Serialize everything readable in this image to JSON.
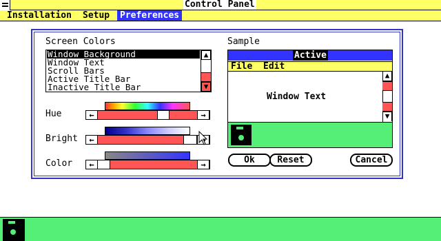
{
  "window": {
    "title": "Control Panel"
  },
  "menubar": {
    "items": [
      "Installation",
      "Setup",
      "Preferences"
    ],
    "active": "Preferences"
  },
  "screen_colors": {
    "heading": "Screen Colors",
    "items": [
      "Window Background",
      "Window Text",
      "Scroll Bars",
      "Active Title Bar",
      "Inactive Title Bar"
    ],
    "selected": "Window Background"
  },
  "sliders": {
    "hue": {
      "label": "Hue",
      "value": 0.64
    },
    "bright": {
      "label": "Bright",
      "value": 0.93
    },
    "color": {
      "label": "Color",
      "value": 0.12
    }
  },
  "sample": {
    "heading": "Sample",
    "title": "Active",
    "menu": [
      "File",
      "Edit"
    ],
    "text": "Window Text"
  },
  "buttons": {
    "ok": "Ok",
    "reset": "Reset",
    "cancel": "Cancel"
  },
  "colors": {
    "title_bar": "#ffff66",
    "active_title": "#3333ff",
    "highlight": "#ff5555",
    "desktop": "#55ee77"
  }
}
